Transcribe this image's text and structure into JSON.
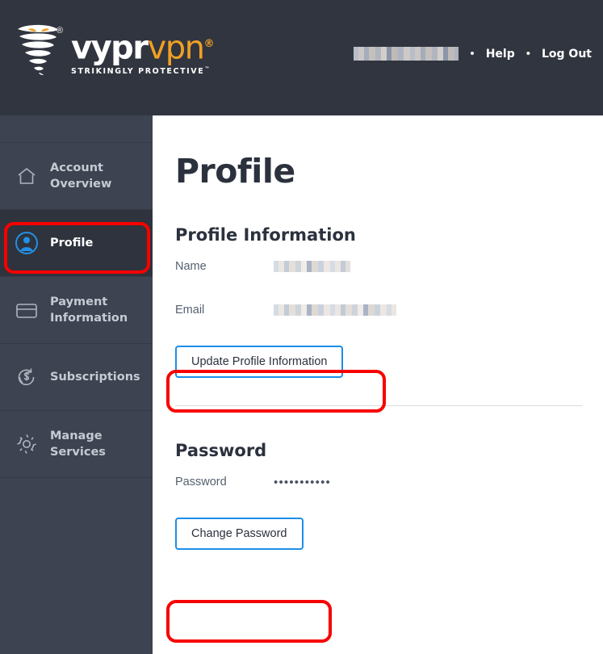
{
  "header": {
    "logo": {
      "word_primary": "vypr",
      "word_secondary": "vpn",
      "registered_mark": "®",
      "tagline": "STRIKINGLY PROTECTIVE",
      "tagline_mark": "™",
      "icon": "tornado-logo-icon",
      "color_primary": "#ffffff",
      "color_secondary": "#f0a024"
    },
    "username_redacted": "",
    "separator": "•",
    "help_label": "Help",
    "logout_label": "Log Out",
    "background_color": "#31353f"
  },
  "sidebar": {
    "background_color": "#3d4350",
    "active_background_color": "#2e333d",
    "items": [
      {
        "label": "Account Overview",
        "icon": "home-icon",
        "active": false
      },
      {
        "label": "Profile",
        "icon": "user-circle-icon",
        "active": true
      },
      {
        "label": "Payment Information",
        "icon": "credit-card-icon",
        "active": false
      },
      {
        "label": "Subscriptions",
        "icon": "refresh-dollar-icon",
        "active": false
      },
      {
        "label": "Manage Services",
        "icon": "gear-icon",
        "active": false
      }
    ]
  },
  "main": {
    "page_title": "Profile",
    "profile_section": {
      "heading": "Profile Information",
      "fields": [
        {
          "label": "Name",
          "value_redacted": ""
        },
        {
          "label": "Email",
          "value_redacted": ""
        }
      ],
      "button_label": "Update Profile Information"
    },
    "password_section": {
      "heading": "Password",
      "field_label": "Password",
      "masked_value": "•••••••••••",
      "button_label": "Change Password"
    },
    "button_border_color": "#1d8ee8",
    "text_color": "#2b313d"
  },
  "annotations": {
    "color": "#f90000",
    "targets": [
      "sidebar-item-profile",
      "update-profile-information-button",
      "change-password-button"
    ]
  }
}
